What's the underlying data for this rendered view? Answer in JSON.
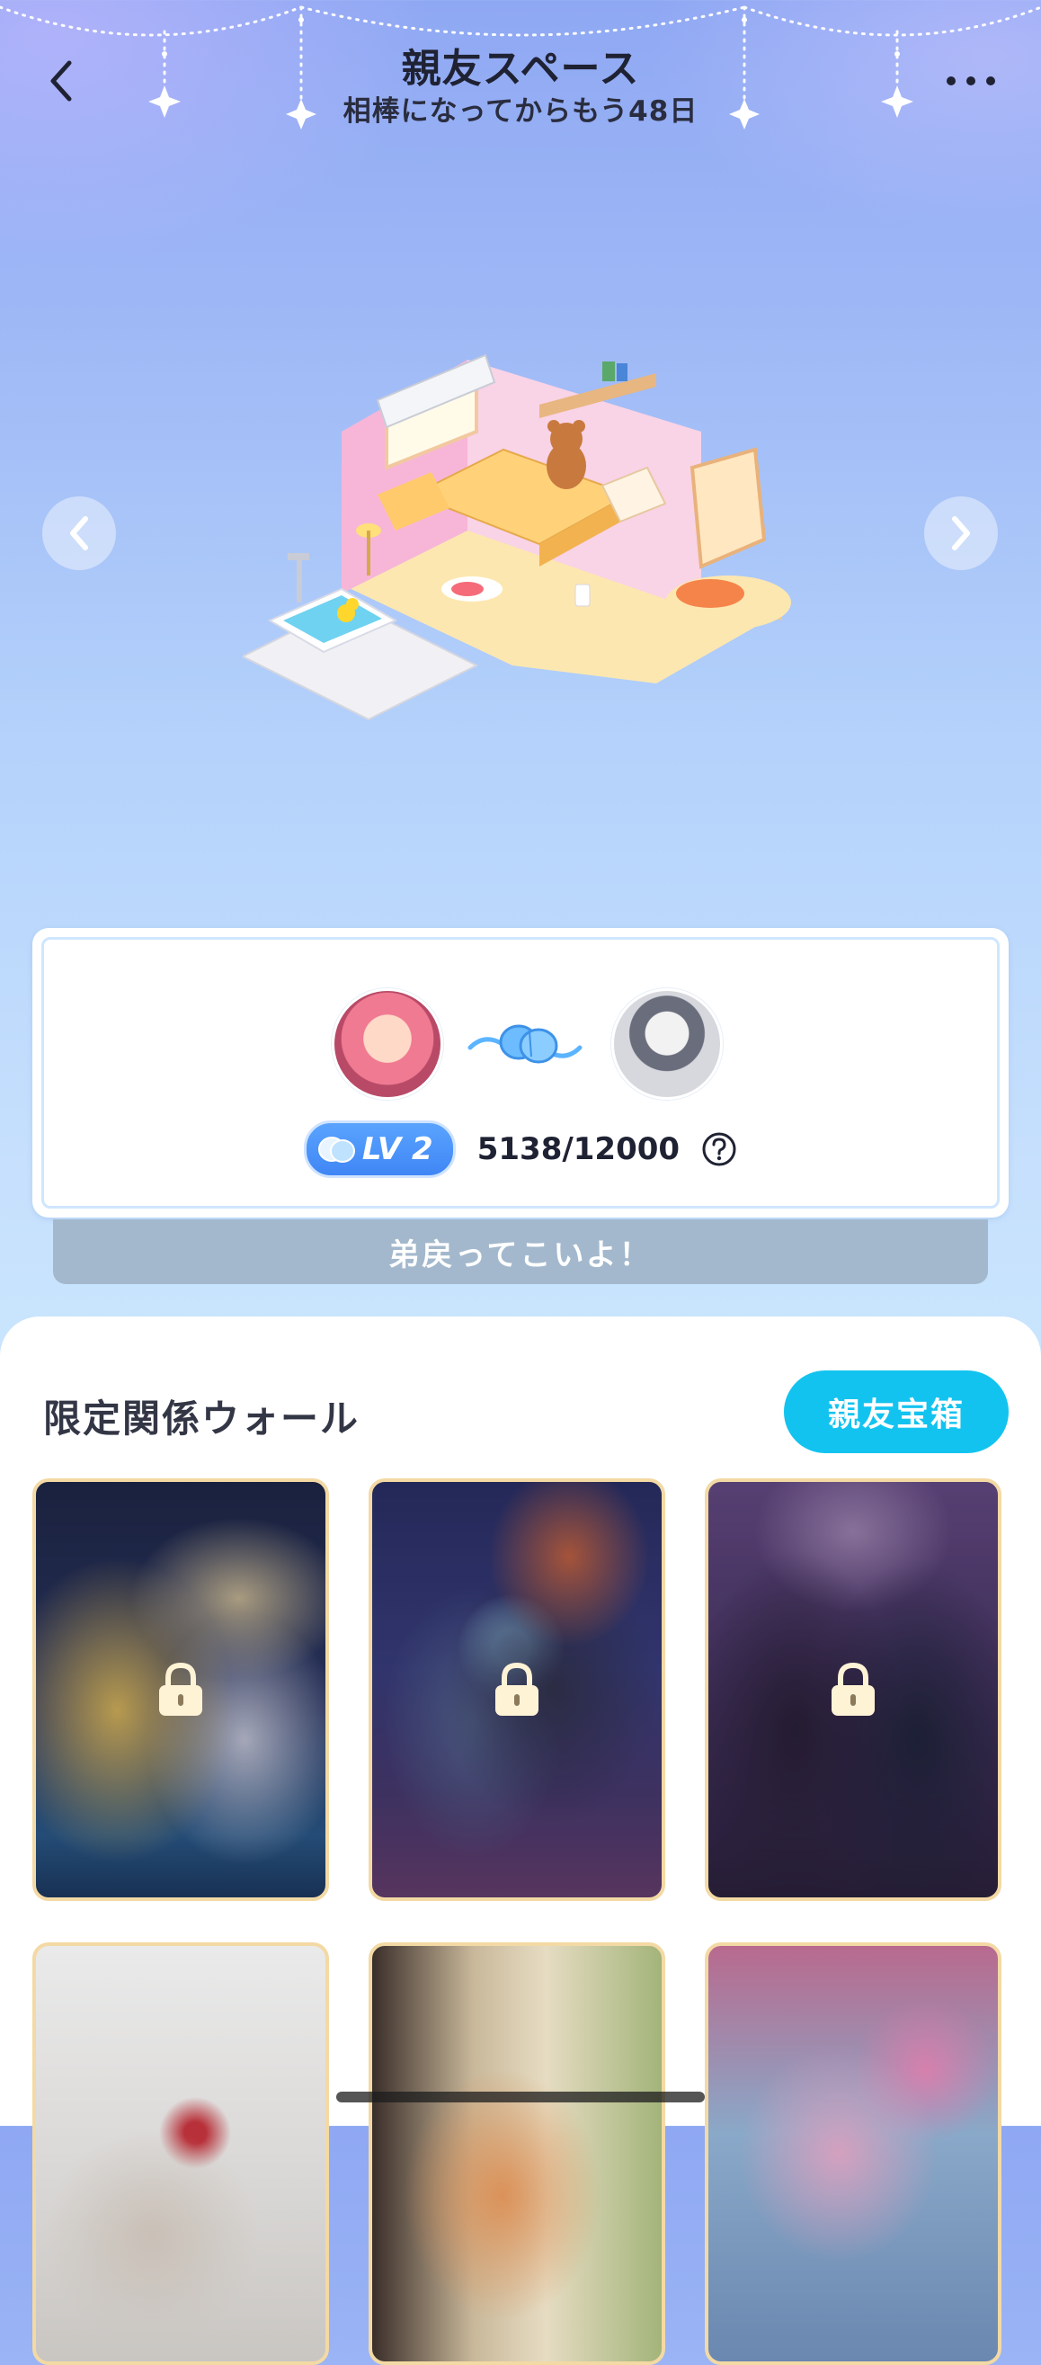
{
  "header": {
    "title": "親友スペース",
    "subtitle": "相棒になってからもう48日"
  },
  "room": {
    "prev_icon": "chevron-left-icon",
    "next_icon": "chevron-right-icon"
  },
  "bond": {
    "level_label": "LV 2",
    "xp_text": "5138/12000",
    "help_icon": "question-circle-icon",
    "xp_progress": 0.4282,
    "message": "弟戻ってこいよ！"
  },
  "wall": {
    "title": "限定関係ウォール",
    "chest_button": "親友宝箱",
    "cards": [
      {
        "locked": true
      },
      {
        "locked": true
      },
      {
        "locked": true
      },
      {
        "locked": false
      },
      {
        "locked": false
      },
      {
        "locked": false
      }
    ]
  },
  "colors": {
    "accent": "#13c3ef",
    "level_badge": "#3f86f5",
    "message_bar": "#a3b8cc",
    "card_border": "#f3d9a4"
  }
}
